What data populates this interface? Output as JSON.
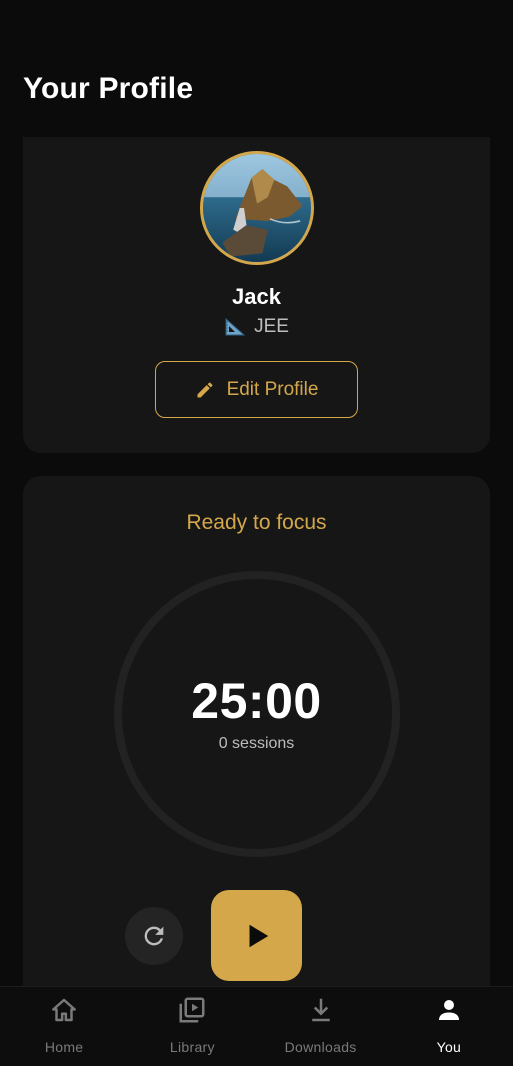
{
  "header": {
    "title": "Your Profile"
  },
  "profile": {
    "name": "Jack",
    "exam_emoji": "📐",
    "exam": "JEE",
    "edit_button_label": "Edit Profile",
    "accent_color": "#d4a84a"
  },
  "focus": {
    "status": "Ready to focus",
    "timer": "25:00",
    "sessions": "0 sessions",
    "reset_icon": "refresh-icon",
    "play_icon": "play-icon"
  },
  "nav": {
    "items": [
      {
        "label": "Home",
        "icon": "home-icon",
        "active": false
      },
      {
        "label": "Library",
        "icon": "library-icon",
        "active": false
      },
      {
        "label": "Downloads",
        "icon": "download-icon",
        "active": false
      },
      {
        "label": "You",
        "icon": "person-icon",
        "active": true
      }
    ]
  }
}
